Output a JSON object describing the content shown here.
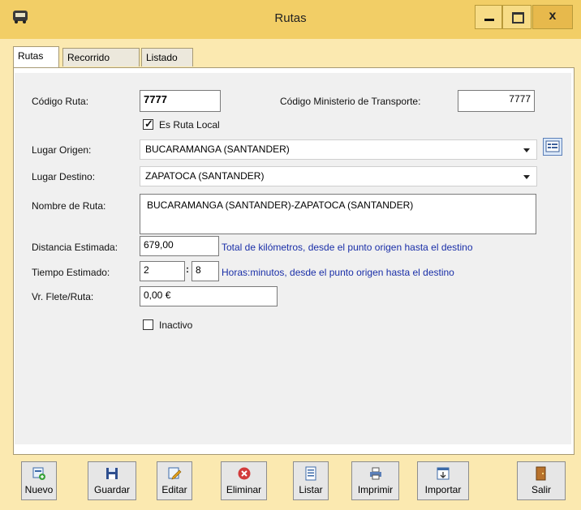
{
  "window": {
    "title": "Rutas"
  },
  "tabs": [
    {
      "label": "Rutas"
    },
    {
      "label": "Recorrido"
    },
    {
      "label": "Listado"
    }
  ],
  "form": {
    "codigo_ruta": {
      "label": "Código Ruta:",
      "value": "7777"
    },
    "codigo_ministerio": {
      "label": "Código Ministerio de Transporte:",
      "value": "7777"
    },
    "es_ruta_local": {
      "label": "Es Ruta Local",
      "checked": true
    },
    "lugar_origen": {
      "label": "Lugar Origen:",
      "value": "BUCARAMANGA (SANTANDER)"
    },
    "lugar_destino": {
      "label": "Lugar Destino:",
      "value": "ZAPATOCA (SANTANDER)"
    },
    "nombre_ruta": {
      "label": "Nombre de Ruta:",
      "value": "BUCARAMANGA (SANTANDER)-ZAPATOCA (SANTANDER)"
    },
    "distancia": {
      "label": "Distancia Estimada:",
      "value": "679,00",
      "note": "Total de kilómetros, desde el punto origen hasta el destino"
    },
    "tiempo": {
      "label": "Tiempo Estimado:",
      "hours": "2",
      "separator": ":",
      "minutes": "8",
      "note": "Horas:minutos, desde el punto origen hasta el destino"
    },
    "flete": {
      "label": "Vr. Flete/Ruta:",
      "value": "0,00 €"
    },
    "inactivo": {
      "label": "Inactivo",
      "checked": false
    }
  },
  "toolbar": {
    "nuevo": "Nuevo",
    "guardar": "Guardar",
    "editar": "Editar",
    "eliminar": "Eliminar",
    "listar": "Listar",
    "imprimir": "Imprimir",
    "importar": "Importar",
    "salir": "Salir"
  },
  "colors": {
    "titlebar": "#f2ce66",
    "frame": "#fbe9b0",
    "note_text": "#1a2fa8",
    "panel": "#f0f0f0"
  },
  "icons": [
    "bus-icon",
    "minimize-icon",
    "maximize-icon",
    "close-icon",
    "browse-list-icon",
    "new-document-icon",
    "save-disk-icon",
    "edit-pencil-icon",
    "delete-x-icon",
    "list-icon",
    "printer-icon",
    "import-icon",
    "exit-door-icon"
  ]
}
